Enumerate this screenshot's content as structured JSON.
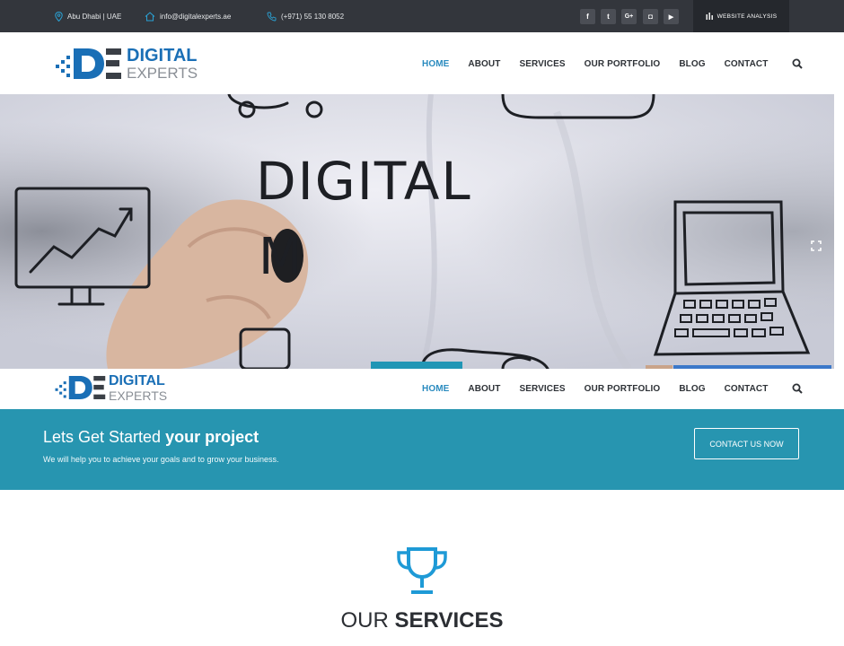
{
  "topbar": {
    "location": "Abu Dhabi | UAE",
    "email": "info@digitalexperts.ae",
    "phone": "(+971) 55 130 8052",
    "social": [
      {
        "name": "facebook-icon",
        "glyph": "f"
      },
      {
        "name": "twitter-icon",
        "glyph": "t"
      },
      {
        "name": "google-plus-icon",
        "glyph": "G+"
      },
      {
        "name": "instagram-icon",
        "glyph": "◘"
      },
      {
        "name": "youtube-icon",
        "glyph": "▶"
      }
    ],
    "website_analysis": "WEBSITE ANALYSIS"
  },
  "logo": {
    "line1": "DIGITAL",
    "line2": "EXPERTS"
  },
  "nav": {
    "items": [
      "HOME",
      "ABOUT",
      "SERVICES",
      "OUR PORTFOLIO",
      "BLOG",
      "CONTACT"
    ],
    "active": "HOME"
  },
  "hero": {
    "board_text": "DIGITAL",
    "board_letter": "M"
  },
  "cta": {
    "title_prefix": "Lets Get Started",
    "title_bold": "your project",
    "subtitle": "We will help you to achieve your goals and to grow your business.",
    "button": "CONTACT US NOW"
  },
  "services": {
    "title_prefix": "OUR",
    "title_bold": "SERVICES"
  },
  "colors": {
    "brand_blue": "#1a6fb6",
    "teal": "#2795b0",
    "topbar_bg": "#33363c",
    "nav_active": "#2a8bbf"
  }
}
